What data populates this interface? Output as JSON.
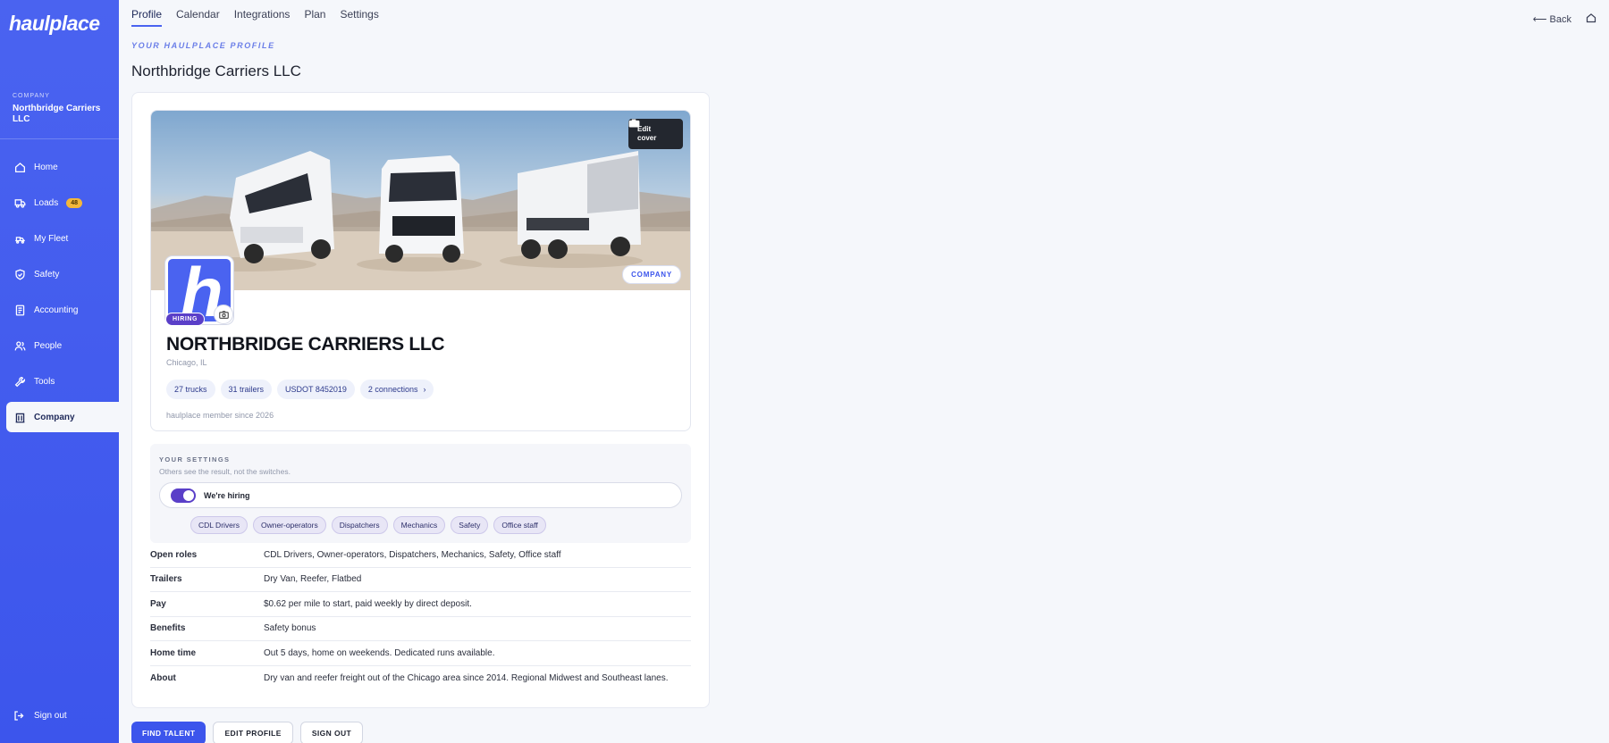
{
  "app": {
    "logo": "haulplace"
  },
  "sidebar": {
    "company_eyebrow": "COMPANY",
    "company_name": "Northbridge Carriers LLC",
    "items": [
      {
        "label": "Home",
        "icon": "home-icon"
      },
      {
        "label": "Loads",
        "icon": "truck-icon",
        "badge": "48"
      },
      {
        "label": "My Fleet",
        "icon": "fleet-icon"
      },
      {
        "label": "Safety",
        "icon": "shield-check-icon"
      },
      {
        "label": "Accounting",
        "icon": "document-icon"
      },
      {
        "label": "People",
        "icon": "people-icon"
      },
      {
        "label": "Tools",
        "icon": "wrench-icon"
      },
      {
        "label": "Company",
        "icon": "building-icon",
        "active": true
      }
    ],
    "sign_out": "Sign out"
  },
  "tabs": [
    {
      "label": "Profile",
      "active": true
    },
    {
      "label": "Calendar"
    },
    {
      "label": "Integrations"
    },
    {
      "label": "Plan"
    },
    {
      "label": "Settings"
    }
  ],
  "topbar": {
    "back": "⟵ Back"
  },
  "header": {
    "eyebrow": "YOUR HAULPLACE PROFILE",
    "title": "Northbridge Carriers LLC"
  },
  "profile": {
    "edit_cover_line1": "Edit",
    "edit_cover_line2": "cover",
    "company_pill": "COMPANY",
    "avatar_letter": "h",
    "hiring_badge": "HIRING",
    "name": "NORTHBRIDGE CARRIERS LLC",
    "location": "Chicago, IL",
    "chips": [
      "27 trucks",
      "31 trailers",
      "USDOT 8452019",
      "2 connections"
    ],
    "chip_arrow": "›",
    "member_since": "haulplace member since 2026"
  },
  "settings": {
    "eyebrow": "YOUR SETTINGS",
    "subtitle": "Others see the result, not the switches.",
    "toggle_label": "We're hiring",
    "toggle_on": true,
    "roles": [
      "CDL Drivers",
      "Owner-operators",
      "Dispatchers",
      "Mechanics",
      "Safety",
      "Office staff"
    ]
  },
  "info": [
    {
      "key": "Open roles",
      "value": "CDL Drivers, Owner-operators, Dispatchers, Mechanics, Safety, Office staff"
    },
    {
      "key": "Trailers",
      "value": "Dry Van, Reefer, Flatbed"
    },
    {
      "key": "Pay",
      "value": "$0.62 per mile to start, paid weekly by direct deposit."
    },
    {
      "key": "Benefits",
      "value": "Safety bonus"
    },
    {
      "key": "Home time",
      "value": "Out 5 days, home on weekends. Dedicated runs available."
    },
    {
      "key": "About",
      "value": "Dry van and reefer freight out of the Chicago area since 2014. Regional Midwest and Southeast lanes."
    }
  ],
  "buttons": {
    "find_talent": "FIND TALENT",
    "edit_profile": "EDIT PROFILE",
    "sign_out": "SIGN OUT"
  },
  "colors": {
    "accent": "#3c55ec",
    "hiring": "#5a3fc8",
    "badge": "#f4b73a"
  }
}
